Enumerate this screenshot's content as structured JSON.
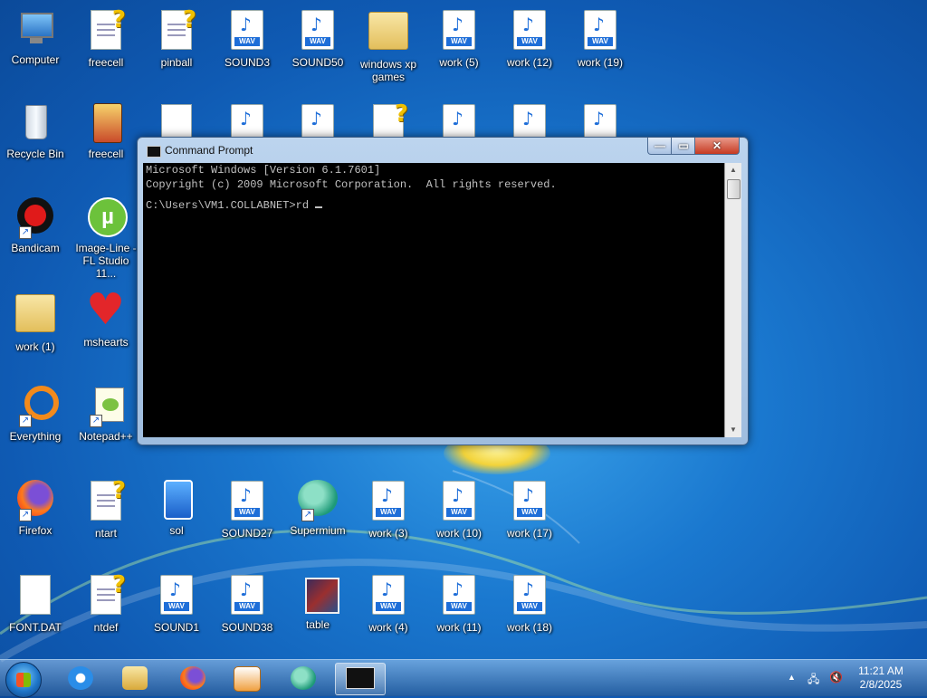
{
  "desktop": {
    "icons": [
      {
        "label": "Computer"
      },
      {
        "label": "freecell"
      },
      {
        "label": "pinball"
      },
      {
        "label": "SOUND3"
      },
      {
        "label": "SOUND50"
      },
      {
        "label": "windows xp games"
      },
      {
        "label": "work (5)"
      },
      {
        "label": "work (12)"
      },
      {
        "label": "work (19)"
      },
      {
        "label": "Recycle Bin"
      },
      {
        "label": "freecell"
      },
      {
        "label": "Bandicam"
      },
      {
        "label": "Image-Line - FL Studio 11..."
      },
      {
        "label": "work (1)"
      },
      {
        "label": "mshearts"
      },
      {
        "label": "Everything"
      },
      {
        "label": "Notepad++"
      },
      {
        "label": "Firefox"
      },
      {
        "label": "ntart"
      },
      {
        "label": "sol"
      },
      {
        "label": "SOUND27"
      },
      {
        "label": "Supermium"
      },
      {
        "label": "work (3)"
      },
      {
        "label": "work (10)"
      },
      {
        "label": "work (17)"
      },
      {
        "label": "FONT.DAT"
      },
      {
        "label": "ntdef"
      },
      {
        "label": "SOUND1"
      },
      {
        "label": "SOUND38"
      },
      {
        "label": "table"
      },
      {
        "label": "work (4)"
      },
      {
        "label": "work (11)"
      },
      {
        "label": "work (18)"
      }
    ],
    "wav_tag": "WAV"
  },
  "cmd_window": {
    "title": "Command Prompt",
    "line1": "Microsoft Windows [Version 6.1.7601]",
    "line2": "Copyright (c) 2009 Microsoft Corporation.  All rights reserved.",
    "line3": "",
    "prompt": "C:\\Users\\VM1.COLLABNET>rd ",
    "minimize_glyph": "—",
    "maximize_glyph": "▭",
    "close_glyph": "✕"
  },
  "taskbar": {
    "pinned": [
      {
        "icon": "internet-explorer-icon"
      },
      {
        "icon": "windows-explorer-icon"
      },
      {
        "icon": "firefox-icon"
      },
      {
        "icon": "media-player-icon"
      },
      {
        "icon": "supermium-icon"
      },
      {
        "icon": "command-prompt-icon"
      }
    ],
    "clock_time": "11:21 AM",
    "clock_date": "2/8/2025",
    "tray_arrow": "▲",
    "colors": {
      "accent": "#1e6ed8",
      "console_bg": "#000000",
      "console_text": "#c0c0c0"
    }
  }
}
